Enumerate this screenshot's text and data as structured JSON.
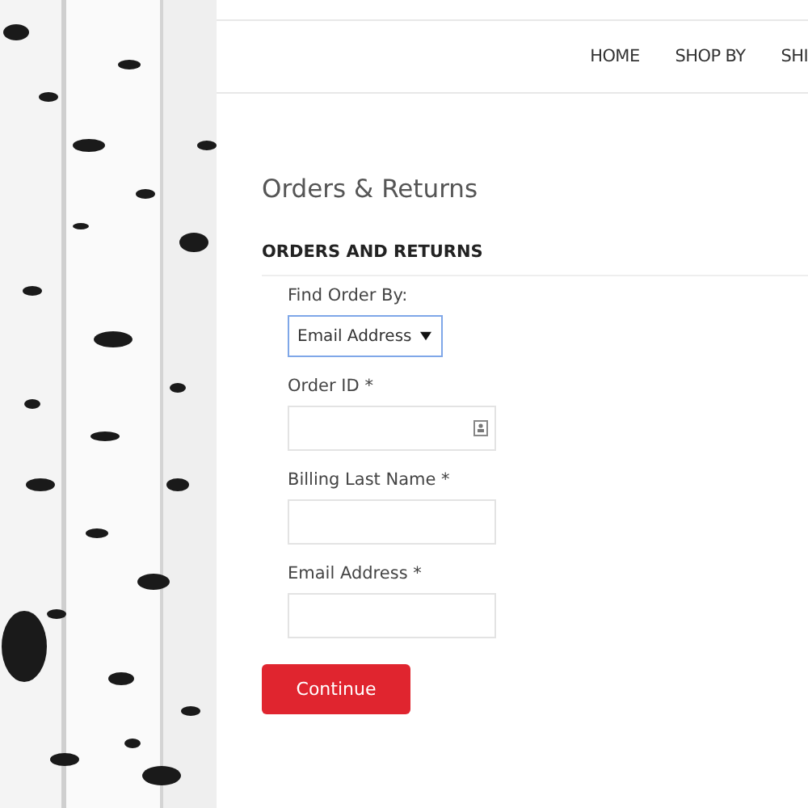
{
  "nav": {
    "items": [
      {
        "label": "HOME"
      },
      {
        "label": "SHOP BY"
      },
      {
        "label": "SHI"
      }
    ]
  },
  "page_title": "Orders & Returns",
  "section_title": "ORDERS AND RETURNS",
  "fields": [
    {
      "kind": "select",
      "label": "Find Order By:",
      "value": "Email Address"
    },
    {
      "kind": "text",
      "label": "Order ID *",
      "has_icon": true
    },
    {
      "kind": "text",
      "label": "Billing Last Name *",
      "has_icon": false
    },
    {
      "kind": "text",
      "label": "Email Address *",
      "has_icon": false
    }
  ],
  "submit_button": "Continue"
}
